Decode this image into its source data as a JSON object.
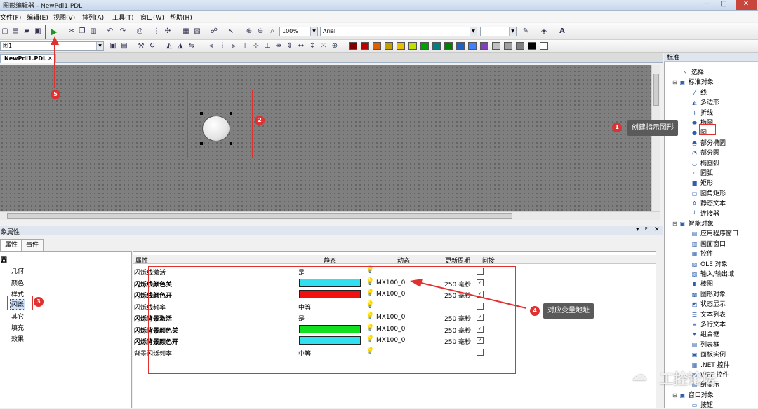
{
  "window": {
    "title": "图形编辑器 - NewPdl1.PDL",
    "min": "—",
    "max": "□",
    "close": "✕"
  },
  "menu": [
    "文件(F)",
    "编辑(E)",
    "视图(V)",
    "排列(A)",
    "工具(T)",
    "窗口(W)",
    "帮助(H)"
  ],
  "toolbar": {
    "zoom": "100%",
    "font": "Arial",
    "layer_combo": "图1"
  },
  "palette": [
    "#800000",
    "#c00000",
    "#e06000",
    "#c0a000",
    "#e8c000",
    "#c0e000",
    "#00a000",
    "#008080",
    "#008000",
    "#2060c0",
    "#4080ff",
    "#8040c0",
    "#c0c0c0",
    "#a0a0a0",
    "#808080",
    "#000000",
    "#ffffff"
  ],
  "doc_tab": {
    "label": "NewPdl1.PDL",
    "close": "✕"
  },
  "props": {
    "title": "象属性",
    "tabs": [
      "属性",
      "事件"
    ],
    "tree": {
      "root": "圆",
      "items": [
        "几何",
        "颜色",
        "样式",
        "闪烁",
        "其它",
        "填充",
        "效果"
      ]
    },
    "headers": {
      "prop": "属性",
      "static": "静态",
      "dynamic": "动态",
      "cycle": "更新周期",
      "indirect": "间接"
    },
    "rows": [
      {
        "name": "闪烁线激活",
        "bold": false,
        "static": "是",
        "swatch": "",
        "dyn": "",
        "cycle": "",
        "checked": false
      },
      {
        "name": "闪烁线颜色关",
        "bold": true,
        "static": "",
        "swatch": "#33e0f0",
        "dyn": "MX100_0",
        "cycle": "250 毫秒",
        "checked": true
      },
      {
        "name": "闪烁线颜色开",
        "bold": true,
        "static": "",
        "swatch": "#f01010",
        "dyn": "MX100_0",
        "cycle": "250 毫秒",
        "checked": true
      },
      {
        "name": "闪烁线频率",
        "bold": false,
        "static": "中等",
        "swatch": "",
        "dyn": "",
        "cycle": "",
        "checked": false
      },
      {
        "name": "闪烁背景激活",
        "bold": true,
        "static": "是",
        "swatch": "",
        "dyn": "MX100_0",
        "cycle": "250 毫秒",
        "checked": true
      },
      {
        "name": "闪烁背景颜色关",
        "bold": true,
        "static": "",
        "swatch": "#10e020",
        "dyn": "MX100_0",
        "cycle": "250 毫秒",
        "checked": true
      },
      {
        "name": "闪烁背景颜色开",
        "bold": true,
        "static": "",
        "swatch": "#33e0f0",
        "dyn": "MX100_0",
        "cycle": "250 毫秒",
        "checked": true
      },
      {
        "name": "背景闪烁频率",
        "bold": false,
        "static": "中等",
        "swatch": "",
        "dyn": "",
        "cycle": "",
        "checked": false
      }
    ]
  },
  "library": {
    "title": "标准",
    "items": [
      {
        "label": "选择",
        "icon": "cursor-icon",
        "glyph": "↖",
        "indent": 1
      },
      {
        "label": "标准对象",
        "icon": "folder-icon",
        "glyph": "▣",
        "indent": 0
      },
      {
        "label": "线",
        "icon": "line-icon",
        "glyph": "╱",
        "indent": 2
      },
      {
        "label": "多边形",
        "icon": "polygon-icon",
        "glyph": "◭",
        "indent": 2
      },
      {
        "label": "折线",
        "icon": "polyline-icon",
        "glyph": "⌇",
        "indent": 2
      },
      {
        "label": "椭圆",
        "icon": "ellipse-icon",
        "glyph": "⬬",
        "indent": 2
      },
      {
        "label": "圆",
        "icon": "circle-icon",
        "glyph": "●",
        "indent": 2
      },
      {
        "label": "部分椭圆",
        "icon": "partial-ellipse-icon",
        "glyph": "◓",
        "indent": 2
      },
      {
        "label": "部分圆",
        "icon": "partial-circle-icon",
        "glyph": "◔",
        "indent": 2
      },
      {
        "label": "椭圆弧",
        "icon": "ellipse-arc-icon",
        "glyph": "◡",
        "indent": 2
      },
      {
        "label": "圆弧",
        "icon": "arc-icon",
        "glyph": "◜",
        "indent": 2
      },
      {
        "label": "矩形",
        "icon": "rectangle-icon",
        "glyph": "■",
        "indent": 2
      },
      {
        "label": "圆角矩形",
        "icon": "rounded-rect-icon",
        "glyph": "▢",
        "indent": 2
      },
      {
        "label": "静态文本",
        "icon": "text-icon",
        "glyph": "A",
        "indent": 2
      },
      {
        "label": "连接器",
        "icon": "connector-icon",
        "glyph": "┘",
        "indent": 2
      },
      {
        "label": "智能对象",
        "icon": "folder-icon",
        "glyph": "▣",
        "indent": 0
      },
      {
        "label": "应用程序窗口",
        "icon": "app-window-icon",
        "glyph": "▤",
        "indent": 2
      },
      {
        "label": "画面窗口",
        "icon": "picture-window-icon",
        "glyph": "▥",
        "indent": 2
      },
      {
        "label": "控件",
        "icon": "control-icon",
        "glyph": "▦",
        "indent": 2
      },
      {
        "label": "OLE 对象",
        "icon": "ole-icon",
        "glyph": "▧",
        "indent": 2
      },
      {
        "label": "输入/输出域",
        "icon": "io-field-icon",
        "glyph": "▨",
        "indent": 2
      },
      {
        "label": "棒图",
        "icon": "bar-icon",
        "glyph": "▮",
        "indent": 2
      },
      {
        "label": "图形对象",
        "icon": "graphic-icon",
        "glyph": "▩",
        "indent": 2
      },
      {
        "label": "状态显示",
        "icon": "status-icon",
        "glyph": "◩",
        "indent": 2
      },
      {
        "label": "文本列表",
        "icon": "textlist-icon",
        "glyph": "☰",
        "indent": 2
      },
      {
        "label": "多行文本",
        "icon": "multiline-icon",
        "glyph": "≡",
        "indent": 2
      },
      {
        "label": "组合框",
        "icon": "combobox-icon",
        "glyph": "▾",
        "indent": 2
      },
      {
        "label": "列表框",
        "icon": "listbox-icon",
        "glyph": "▤",
        "indent": 2
      },
      {
        "label": "面板实例",
        "icon": "faceplate-icon",
        "glyph": "▣",
        "indent": 2
      },
      {
        "label": ".NET 控件",
        "icon": "net-control-icon",
        "glyph": "▦",
        "indent": 2
      },
      {
        "label": "WPF 控件",
        "icon": "wpf-control-icon",
        "glyph": "▦",
        "indent": 2
      },
      {
        "label": "组显示",
        "icon": "group-display-icon",
        "glyph": "▤",
        "indent": 2
      },
      {
        "label": "窗口对象",
        "icon": "folder-icon",
        "glyph": "▣",
        "indent": 0
      },
      {
        "label": "按钮",
        "icon": "button-icon",
        "glyph": "▭",
        "indent": 2
      }
    ]
  },
  "annotations": {
    "1": "1",
    "2": "2",
    "3": "3",
    "4": "4",
    "5": "5",
    "create_shape": "创建指示图形",
    "var_address": "对应变量地址"
  },
  "watermark": "工控论坛"
}
